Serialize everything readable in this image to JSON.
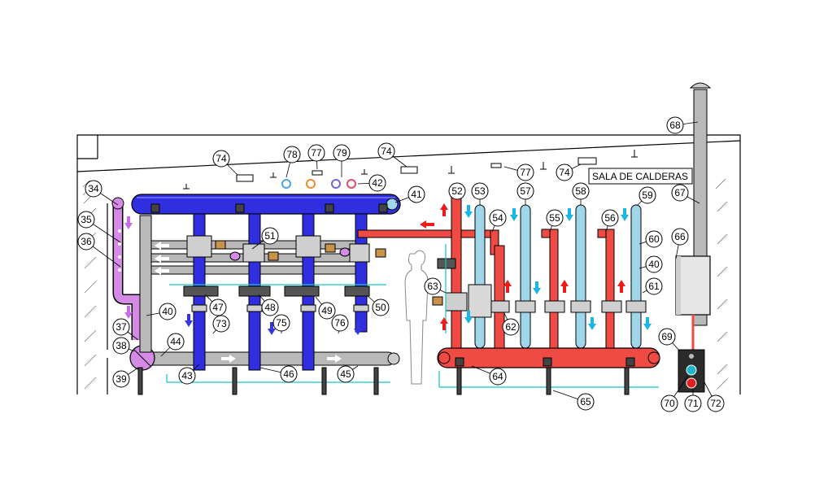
{
  "diagram": {
    "room_label": "SALA DE CALDERAS",
    "callouts": [
      "34",
      "35",
      "36",
      "37",
      "38",
      "39",
      "40",
      "41",
      "42",
      "43",
      "44",
      "45",
      "46",
      "47",
      "48",
      "49",
      "50",
      "51",
      "52",
      "53",
      "54",
      "55",
      "56",
      "57",
      "58",
      "59",
      "60",
      "61",
      "62",
      "63",
      "64",
      "65",
      "66",
      "67",
      "68",
      "69",
      "70",
      "71",
      "72",
      "73",
      "74",
      "75",
      "76",
      "77",
      "78",
      "79"
    ],
    "colors": {
      "cold_pipe": "#2f2fe0",
      "cold_pipe_light": "#9fd6ea",
      "hot_pipe": "#ef4b44",
      "return_pipe": "#b9b9b9",
      "magenta_pipe": "#d58ae5",
      "cyan_line": "#12c6cf",
      "valve_brown": "#c7924a",
      "arrow_red": "#ee1b1b",
      "arrow_cyan": "#19b6e6",
      "arrow_blue": "#3636e0",
      "arrow_violet": "#c86be8"
    }
  }
}
